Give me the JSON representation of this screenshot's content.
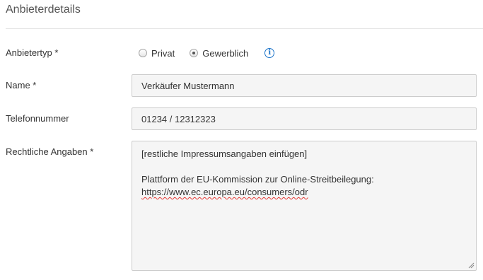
{
  "section": {
    "title": "Anbieterdetails"
  },
  "provider_type": {
    "label": "Anbietertyp *",
    "options": [
      {
        "label": "Privat",
        "checked": false
      },
      {
        "label": "Gewerblich",
        "checked": true
      }
    ],
    "info_icon": "info-circle-icon"
  },
  "name": {
    "label": "Name *",
    "value": "Verkäufer Mustermann"
  },
  "phone": {
    "label": "Telefonnummer",
    "value": "01234 / 12312323"
  },
  "legal": {
    "label": "Rechtliche Angaben *",
    "line1": "[restliche Impressumsangaben einfügen]",
    "line2": "",
    "line3": "Plattform der EU-Kommission zur Online-Streitbeilegung:",
    "line4": "https://www.ec.europa.eu/consumers/odr"
  },
  "colors": {
    "accent": "#1a73c9",
    "field_bg": "#f5f5f5",
    "field_border": "#cccccc",
    "spellcheck": "#e53935"
  }
}
